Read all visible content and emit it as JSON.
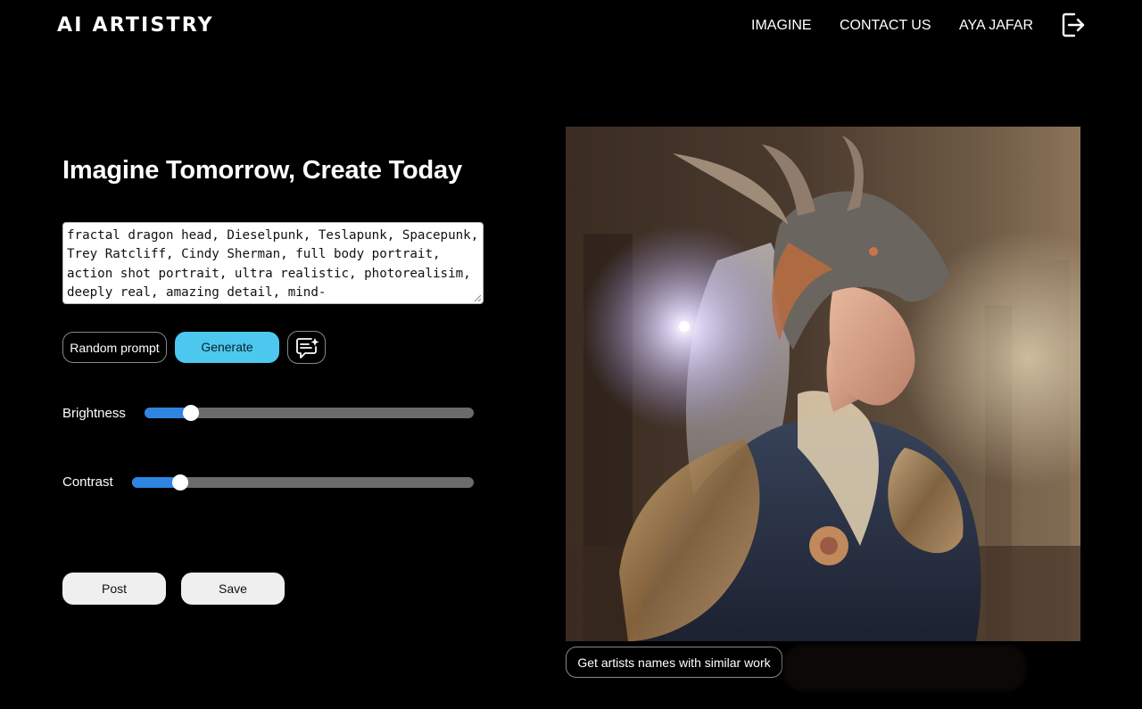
{
  "header": {
    "brand": "AI ARTISTRY",
    "nav": [
      {
        "label": "IMAGINE"
      },
      {
        "label": "CONTACT US"
      },
      {
        "label": "AYA JAFAR"
      }
    ],
    "logout_icon": "logout-icon"
  },
  "main": {
    "title": "Imagine Tomorrow, Create Today",
    "prompt": {
      "value": "fractal dragon head, Dieselpunk, Teslapunk, Spacepunk, Trey Ratcliff, Cindy Sherman, full body portrait, action shot portrait, ultra realistic, photorealisim, deeply real, amazing detail, mind-"
    },
    "buttons": {
      "random": "Random prompt",
      "generate": "Generate",
      "enhance_icon": "chat-sparkle-icon",
      "post": "Post",
      "save": "Save"
    },
    "sliders": {
      "brightness": {
        "label": "Brightness",
        "value": 0.14
      },
      "contrast": {
        "label": "Contrast",
        "value": 0.14
      }
    }
  },
  "artwork": {
    "artists_button": "Get artists names with similar work"
  },
  "colors": {
    "background": "#000000",
    "accent": "#4cc8ef",
    "slider_fill": "#2f86e0",
    "slider_track": "#6b6b6b"
  }
}
